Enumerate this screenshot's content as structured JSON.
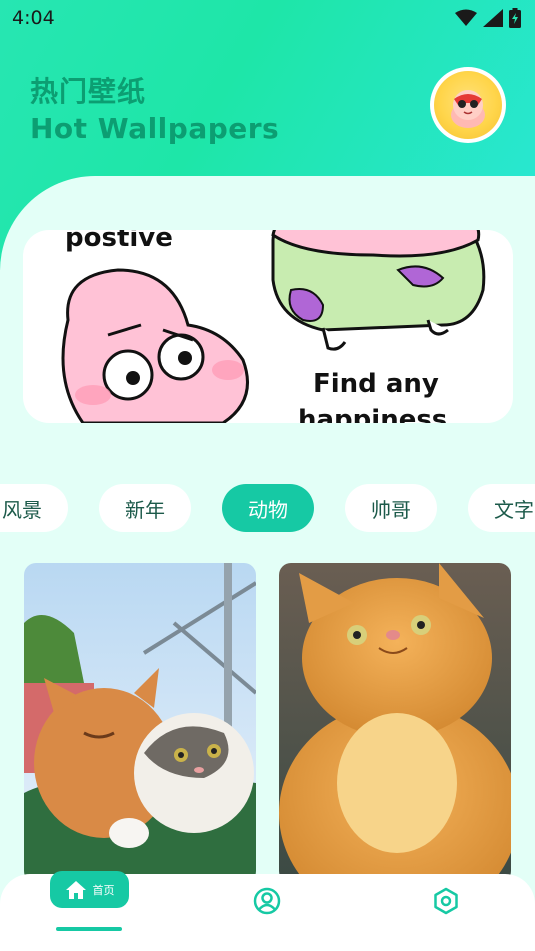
{
  "status_bar": {
    "time": "4:04"
  },
  "header": {
    "title_cn": "热门壁纸",
    "title_en": "Hot Wallpapers"
  },
  "banner": {
    "text_top": "postive",
    "text_bottom_1": "Find any",
    "text_bottom_2": "happiness"
  },
  "categories": [
    {
      "label": "风景",
      "active": false
    },
    {
      "label": "新年",
      "active": false
    },
    {
      "label": "动物",
      "active": true
    },
    {
      "label": "帅哥",
      "active": false
    },
    {
      "label": "文字",
      "active": false
    }
  ],
  "wallpapers": [
    {
      "name": "two-cats-hugging"
    },
    {
      "name": "orange-cat-looking-up"
    }
  ],
  "bottom_nav": {
    "home_label": "首页",
    "items": [
      {
        "icon": "home-icon",
        "label": "首页",
        "active": true
      },
      {
        "icon": "user-icon",
        "active": false
      },
      {
        "icon": "settings-icon",
        "active": false
      }
    ]
  },
  "colors": {
    "accent": "#16c9a4",
    "title": "#0c9e72",
    "panel": "#e3fff7"
  }
}
